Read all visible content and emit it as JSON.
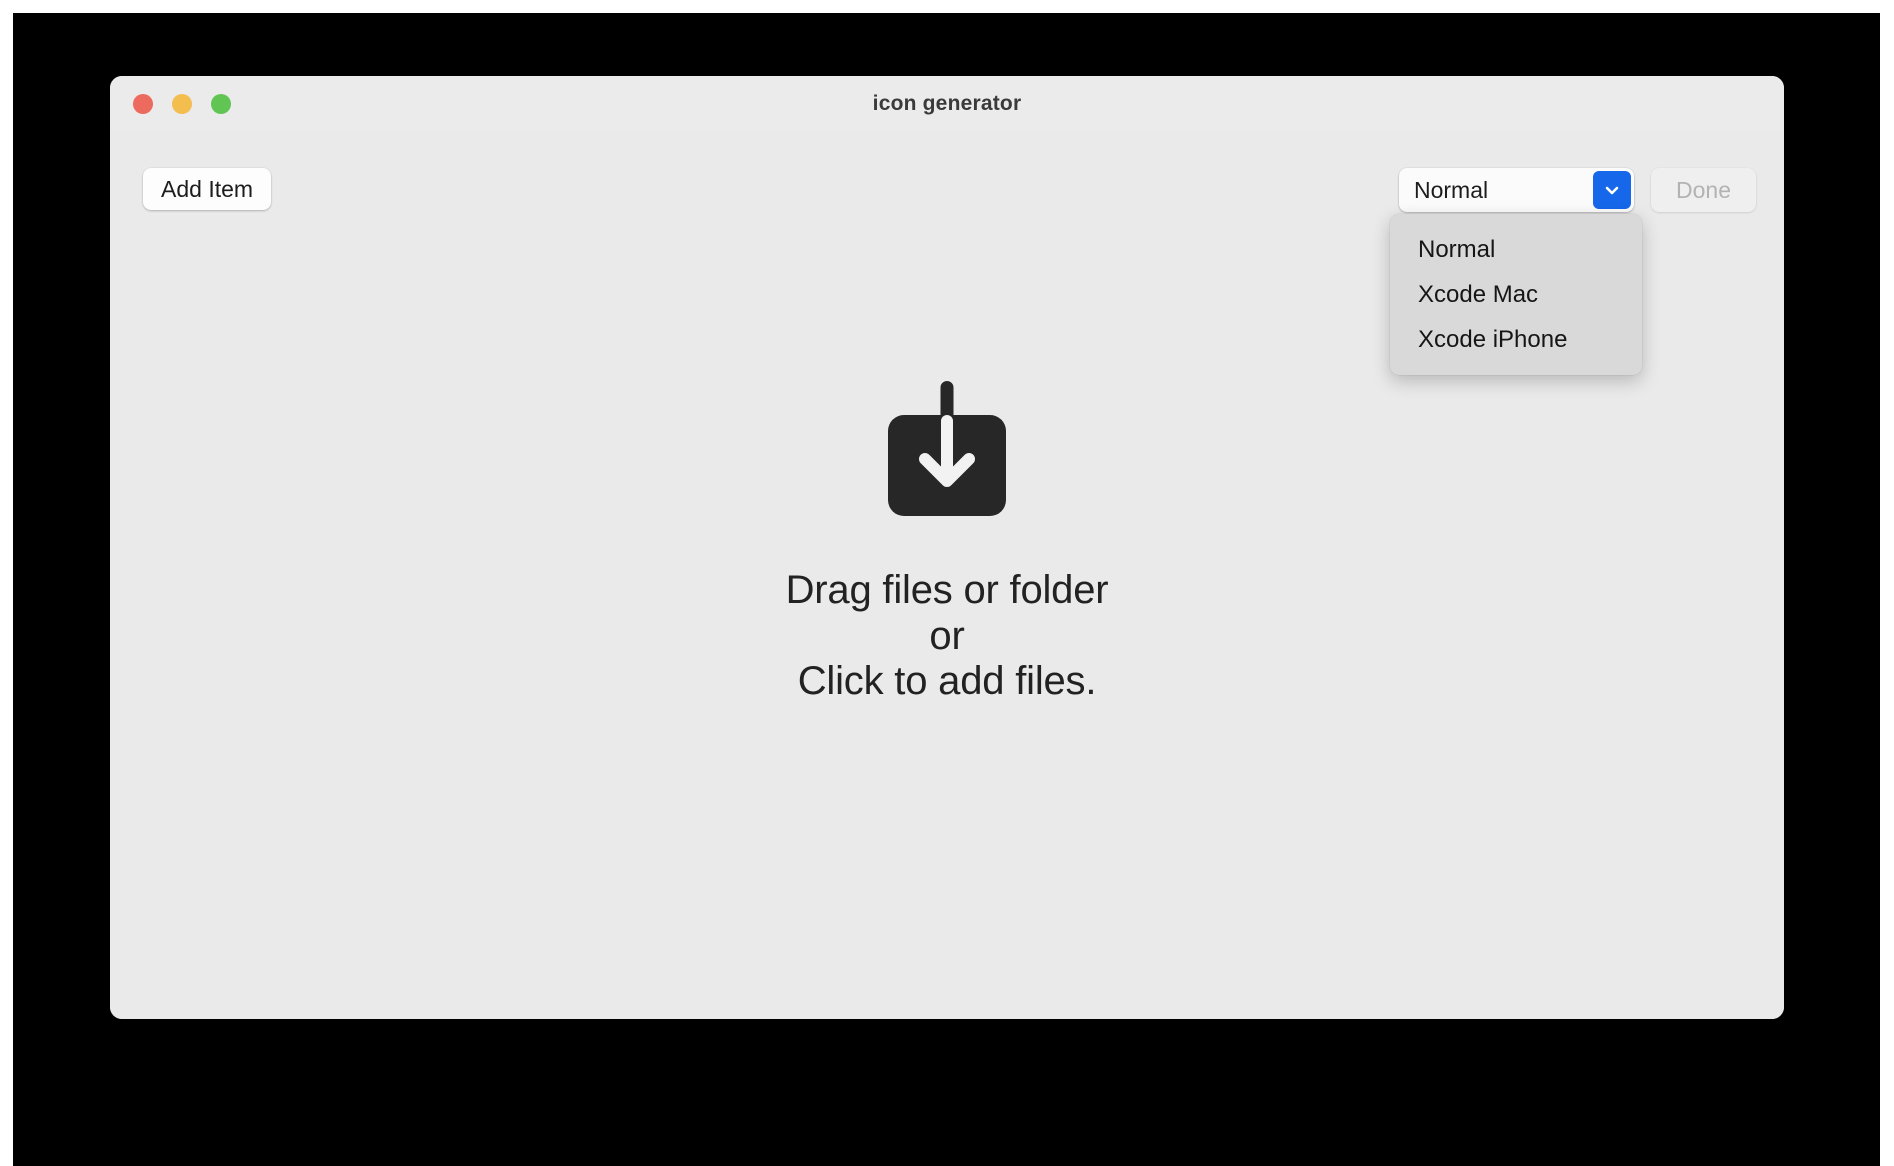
{
  "window": {
    "title": "icon generator",
    "traffic_lights": [
      {
        "name": "close",
        "color": "#ec6a5e"
      },
      {
        "name": "minimize",
        "color": "#f4bd4f"
      },
      {
        "name": "zoom",
        "color": "#61c554"
      }
    ]
  },
  "toolbar": {
    "add_item_label": "Add Item",
    "done_label": "Done",
    "done_disabled": true,
    "mode_select": {
      "selected": "Normal",
      "expanded": true,
      "chevron_icon": "chevron-down-icon",
      "accent_color": "#1667ea",
      "options": [
        "Normal",
        "Xcode Mac",
        "Xcode iPhone"
      ]
    }
  },
  "drop_zone": {
    "icon": "download-arrow-icon",
    "line1": "Drag files or folder",
    "line2": "or",
    "line3": "Click to add files."
  }
}
